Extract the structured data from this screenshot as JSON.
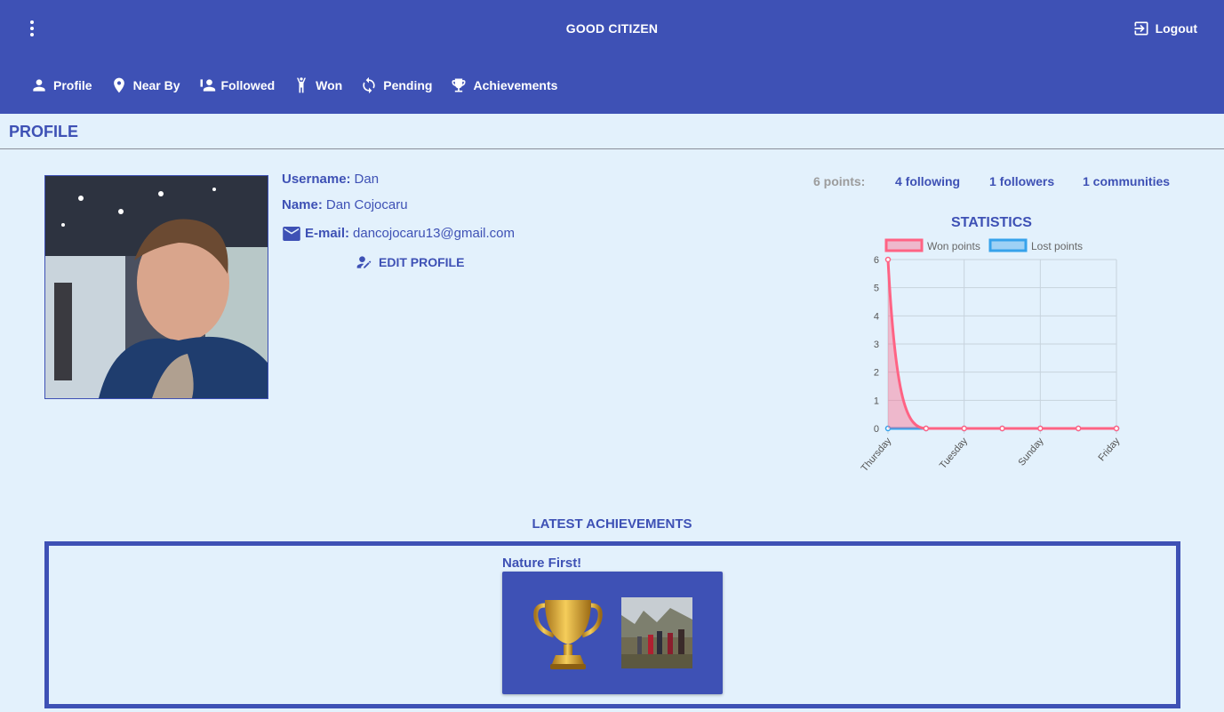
{
  "header": {
    "title": "GOOD CITIZEN",
    "logout_label": "Logout"
  },
  "nav": {
    "items": [
      {
        "label": "Profile",
        "icon": "person-icon"
      },
      {
        "label": "Near By",
        "icon": "location-pin-icon"
      },
      {
        "label": "Followed",
        "icon": "followed-icon"
      },
      {
        "label": "Won",
        "icon": "winner-icon"
      },
      {
        "label": "Pending",
        "icon": "sync-icon"
      },
      {
        "label": "Achievements",
        "icon": "trophy-icon"
      }
    ]
  },
  "page": {
    "title": "PROFILE"
  },
  "profile": {
    "username_label": "Username:",
    "username": "Dan",
    "name_label": "Name:",
    "name": "Dan Cojocaru",
    "email_label": "E-mail:",
    "email": "dancojocaru13@gmail.com",
    "edit_label": "EDIT PROFILE"
  },
  "stats": {
    "points": "6 points:",
    "following": "4 following",
    "followers": "1 followers",
    "communities": "1 communities",
    "title": "STATISTICS"
  },
  "chart_data": {
    "type": "line",
    "title": "STATISTICS",
    "categories": [
      "Thursday",
      "",
      "Tuesday",
      "",
      "Sunday",
      "",
      "Friday"
    ],
    "tick_labels": [
      "Thursday",
      "Tuesday",
      "Sunday",
      "Friday"
    ],
    "series": [
      {
        "name": "Won points",
        "values": [
          6,
          0,
          0,
          0,
          0,
          0,
          0
        ],
        "color": "#ff6384",
        "fill": "rgba(255,99,132,0.4)"
      },
      {
        "name": "Lost points",
        "values": [
          0,
          0,
          0,
          0,
          0,
          0,
          0
        ],
        "color": "#36a2eb",
        "fill": "rgba(54,162,235,0.4)"
      }
    ],
    "ylim": [
      0,
      6
    ],
    "yticks": [
      0,
      1,
      2,
      3,
      4,
      5,
      6
    ],
    "grid": true,
    "legend": "top"
  },
  "achievements": {
    "title": "LATEST ACHIEVEMENTS",
    "items": [
      {
        "name": "Nature First!"
      }
    ]
  },
  "colors": {
    "primary": "#3e51b5",
    "background": "#e3f1fc"
  }
}
